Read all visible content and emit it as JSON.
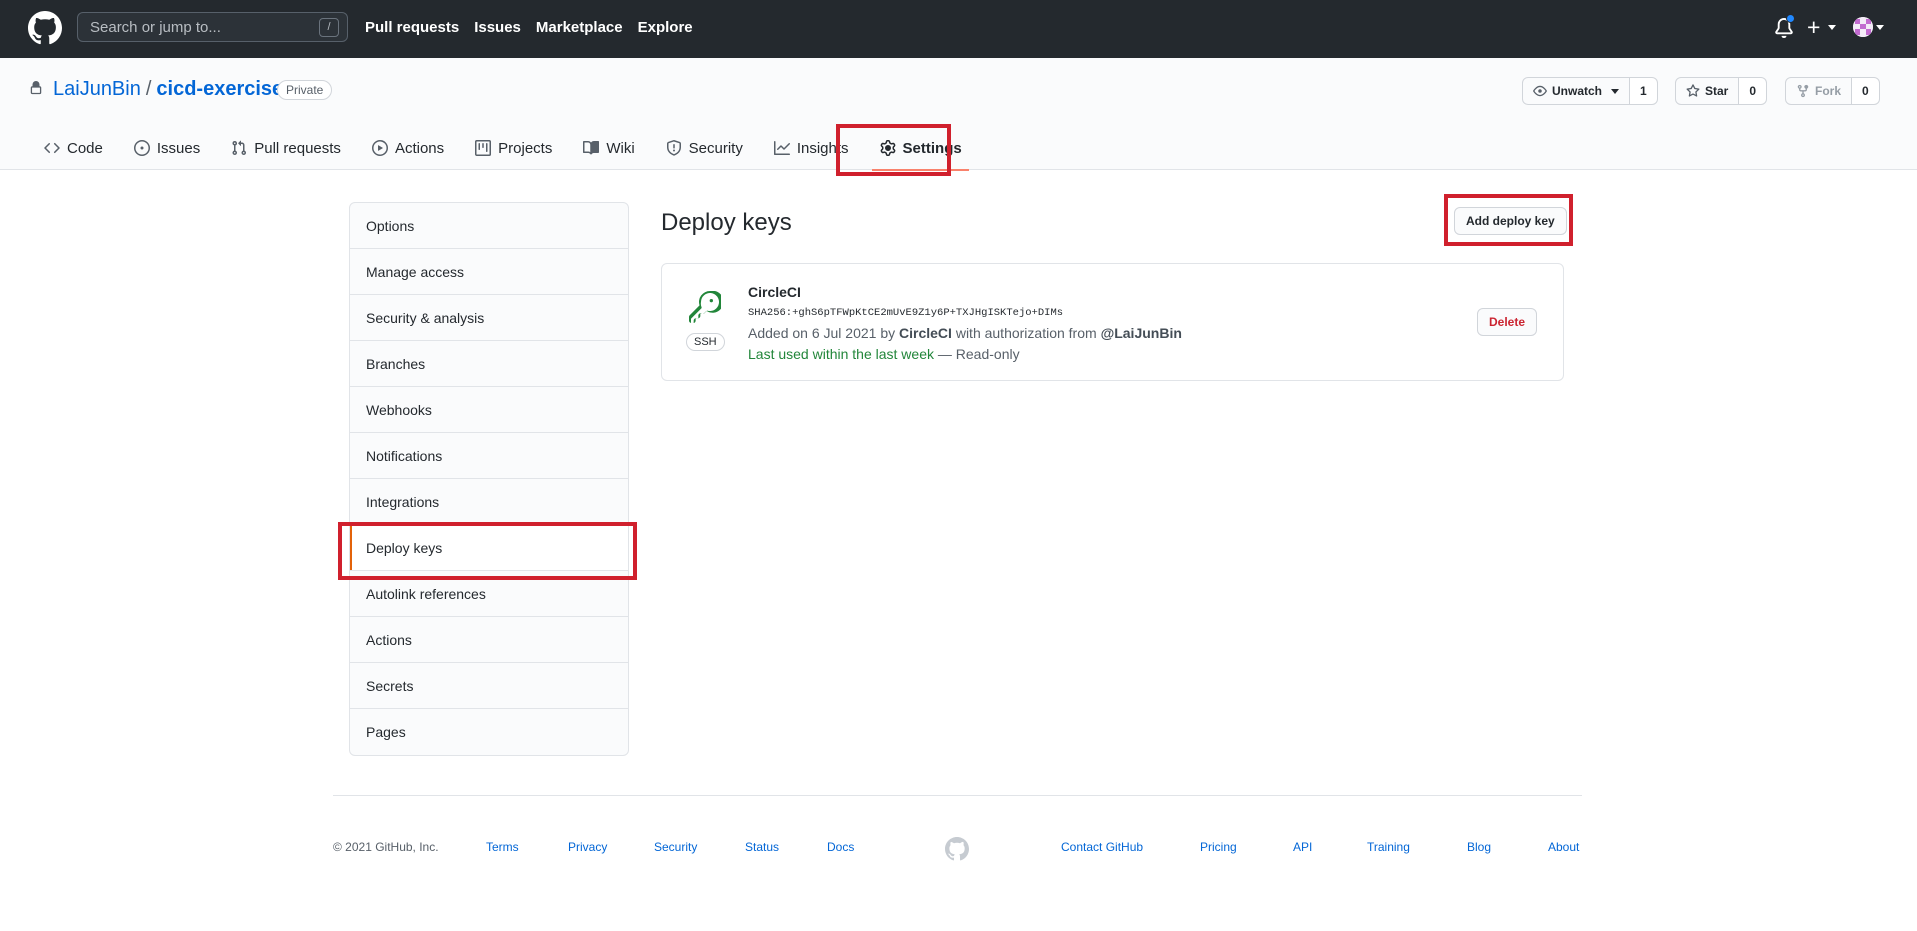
{
  "header": {
    "search_placeholder": "Search or jump to...",
    "slash_hint": "/",
    "nav": [
      "Pull requests",
      "Issues",
      "Marketplace",
      "Explore"
    ],
    "plus_label": "+"
  },
  "repo": {
    "owner": "LaiJunBin",
    "separator": "/",
    "name": "cicd-exercise",
    "visibility": "Private",
    "watch_label": "Unwatch",
    "watch_count": "1",
    "star_label": "Star",
    "star_count": "0",
    "fork_label": "Fork",
    "fork_count": "0"
  },
  "tabs": [
    {
      "label": "Code",
      "icon": "code-icon"
    },
    {
      "label": "Issues",
      "icon": "issue-icon"
    },
    {
      "label": "Pull requests",
      "icon": "pull-request-icon"
    },
    {
      "label": "Actions",
      "icon": "play-icon"
    },
    {
      "label": "Projects",
      "icon": "project-icon"
    },
    {
      "label": "Wiki",
      "icon": "book-icon"
    },
    {
      "label": "Security",
      "icon": "shield-icon"
    },
    {
      "label": "Insights",
      "icon": "graph-icon"
    },
    {
      "label": "Settings",
      "icon": "gear-icon",
      "selected": true
    }
  ],
  "settings_menu": [
    "Options",
    "Manage access",
    "Security & analysis",
    "Branches",
    "Webhooks",
    "Notifications",
    "Integrations",
    "Deploy keys",
    "Autolink references",
    "Actions",
    "Secrets",
    "Pages"
  ],
  "selected_menu_item": "Deploy keys",
  "main": {
    "title": "Deploy keys",
    "add_button": "Add deploy key",
    "key": {
      "type_badge": "SSH",
      "name": "CircleCI",
      "fingerprint": "SHA256:+ghS6pTFWpKtCE2mUvE9Z1y6P+TXJHgISKTejo+DIMs",
      "added_prefix": "Added on 6 Jul 2021 by",
      "added_by": "CircleCI",
      "auth_text": "with authorization from",
      "auth_user": "@LaiJunBin",
      "last_used": "Last used within the last week",
      "access": " — Read-only",
      "delete_button": "Delete"
    }
  },
  "footer": {
    "copyright": "© 2021 GitHub, Inc.",
    "links": [
      "Terms",
      "Privacy",
      "Security",
      "Status",
      "Docs",
      "Contact GitHub",
      "Pricing",
      "API",
      "Training",
      "Blog",
      "About"
    ]
  },
  "colors": {
    "header_bg": "#24292e",
    "link": "#0366d6",
    "selected_tab_underline": "#f9826c",
    "annotation_red": "#d0202d",
    "key_green": "#22863a",
    "delete_red": "#cb2431"
  }
}
